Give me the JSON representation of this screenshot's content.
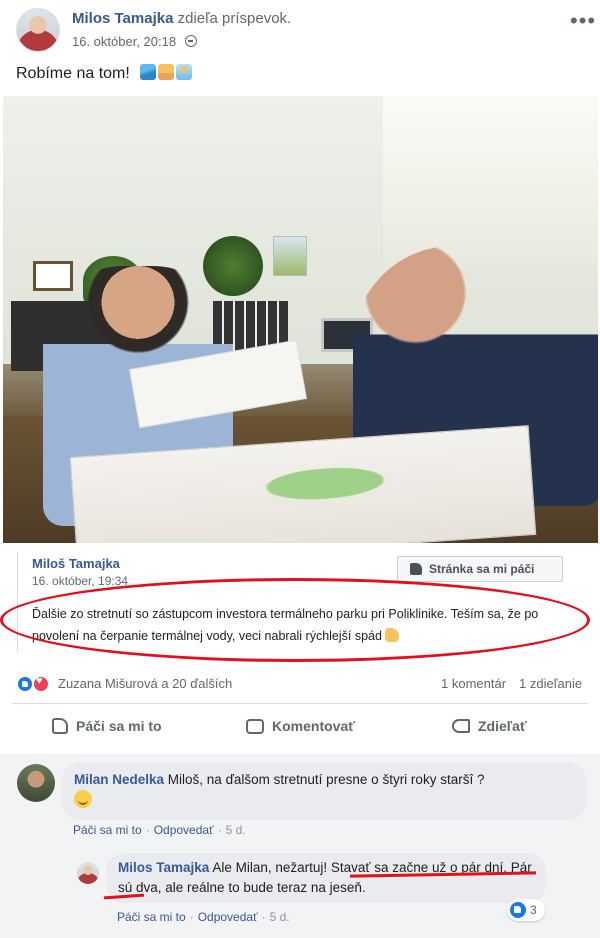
{
  "post": {
    "author": "Milos Tamajka",
    "action": "zdieľa príspevok.",
    "timestamp": "16. október, 20:18",
    "text": "Robíme na tom!",
    "emojis": [
      "wave-emoji",
      "beach-emoji",
      "swim-emoji"
    ]
  },
  "shared": {
    "author": "Miloš Tamajka",
    "timestamp": "16. október, 19:34",
    "like_page_label": "Stránka sa mi páči",
    "text": "Ďalšie zo stretnutí so zástupcom investora termálneho parku pri Poliklinike. Teším sa, že po povolení na čerpanie termálnej vody, veci nabrali rýchlejší spád"
  },
  "reactions": {
    "names": "Zuzana Mišurová a 20 ďalších",
    "comments": "1 komentár",
    "shares": "1 zdieľanie"
  },
  "actions": {
    "like": "Páči sa mi to",
    "comment": "Komentovať",
    "share": "Zdieľať"
  },
  "comments": [
    {
      "author": "Milan Nedelka",
      "text": "Miloš, na ďalšom stretnutí presne o štyri roky staršî ?",
      "like": "Páči sa mi to",
      "reply": "Odpovedať",
      "time": "5 d."
    },
    {
      "author": "Milos Tamajka",
      "text_part1": "Ale Milan, nežartuj! ",
      "text_part2": "Stavať sa začne už o pár dní",
      "text_part3": ". Pár sú dva, ale reálne to bude teraz na jeseň.",
      "like": "Páči sa mi to",
      "reply": "Odpovedať",
      "time": "5 d.",
      "reaction_count": "3"
    }
  ],
  "colors": {
    "link": "#365899",
    "annotation_red": "#e0101d",
    "like_blue": "#1877f2"
  }
}
